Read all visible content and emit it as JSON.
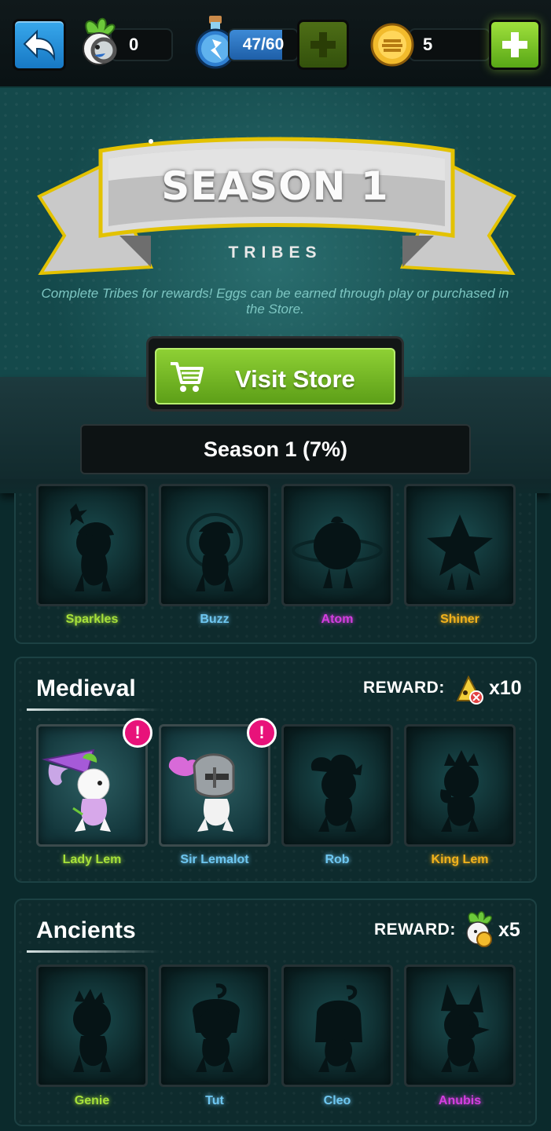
{
  "topbar": {
    "lem_count": "0",
    "energy_text": "47/60",
    "energy_value": 47,
    "energy_max": 60,
    "coin_count": "5",
    "icons": [
      "back-arrow-icon",
      "lem-head-icon",
      "potion-icon",
      "plus-icon",
      "coin-icon",
      "plus-icon"
    ]
  },
  "header": {
    "title": "SEASON 1",
    "subtitle": "TRIBES",
    "tagline": "Complete Tribes for rewards! Eggs can be earned through play or purchased in the Store."
  },
  "store": {
    "button_label": "Visit Store",
    "icon": "cart-icon",
    "progress_label": "Season 1 (7%)"
  },
  "tribes": [
    {
      "title": "",
      "reward_label": "",
      "reward_count": "",
      "characters": [
        {
          "name": "Sparkles",
          "color": "#a6e03a",
          "unlocked": false
        },
        {
          "name": "Buzz",
          "color": "#6ec6f0",
          "unlocked": false
        },
        {
          "name": "Atom",
          "color": "#d43ee0",
          "unlocked": false
        },
        {
          "name": "Shiner",
          "color": "#f2b21c",
          "unlocked": false
        }
      ]
    },
    {
      "title": "Medieval",
      "reward_label": "REWARD:",
      "reward_count": "x10",
      "reward_icon": "egg-ticket-icon",
      "characters": [
        {
          "name": "Lady Lem",
          "color": "#a6e03a",
          "unlocked": true,
          "alert": "!"
        },
        {
          "name": "Sir Lemalot",
          "color": "#6ec6f0",
          "unlocked": true,
          "alert": "!"
        },
        {
          "name": "Rob",
          "color": "#6ec6f0",
          "unlocked": false
        },
        {
          "name": "King Lem",
          "color": "#f2b21c",
          "unlocked": false
        }
      ]
    },
    {
      "title": "Ancients",
      "reward_label": "REWARD:",
      "reward_count": "x5",
      "reward_icon": "lem-head-icon",
      "characters": [
        {
          "name": "Genie",
          "color": "#a6e03a",
          "unlocked": false
        },
        {
          "name": "Tut",
          "color": "#6ec6f0",
          "unlocked": false
        },
        {
          "name": "Cleo",
          "color": "#6ec6f0",
          "unlocked": false
        },
        {
          "name": "Anubis",
          "color": "#d43ee0",
          "unlocked": false
        }
      ]
    }
  ]
}
